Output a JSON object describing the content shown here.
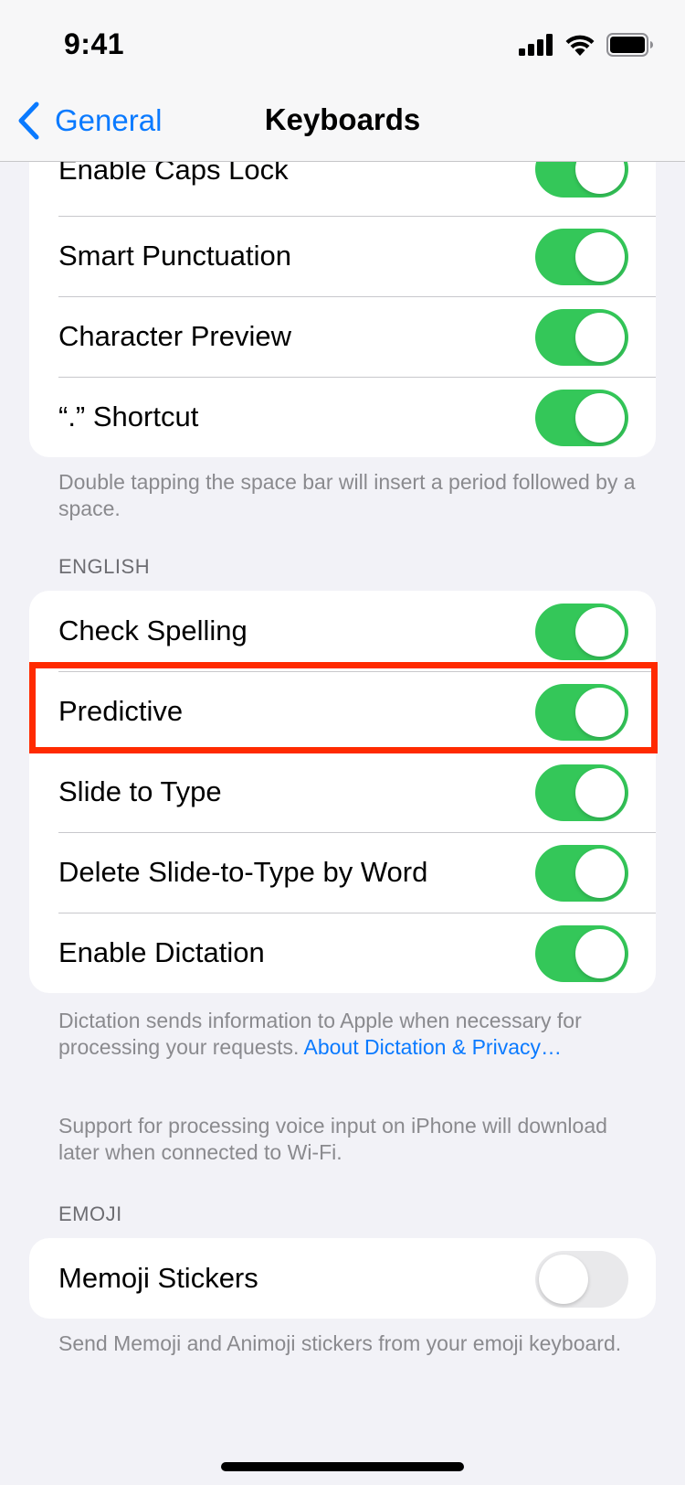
{
  "status_bar": {
    "time": "9:41",
    "icons": [
      "cellular-signal-icon",
      "wifi-icon",
      "battery-icon"
    ]
  },
  "nav": {
    "back_label": "General",
    "title": "Keyboards"
  },
  "group_top": {
    "rows": [
      {
        "label": "Enable Caps Lock",
        "on": true
      },
      {
        "label": "Smart Punctuation",
        "on": true
      },
      {
        "label": "Character Preview",
        "on": true
      },
      {
        "label": "“.” Shortcut",
        "on": true
      }
    ],
    "footer": "Double tapping the space bar will insert a period followed by a space."
  },
  "english": {
    "header": "ENGLISH",
    "rows": [
      {
        "label": "Check Spelling",
        "on": true
      },
      {
        "label": "Predictive",
        "on": true
      },
      {
        "label": "Slide to Type",
        "on": true
      },
      {
        "label": "Delete Slide-to-Type by Word",
        "on": true
      },
      {
        "label": "Enable Dictation",
        "on": true
      }
    ],
    "footer_text": "Dictation sends information to Apple when necessary for processing your requests.",
    "footer_link": "About Dictation & Privacy…",
    "footer_2": "Support for processing voice input on iPhone will download later when connected to Wi-Fi."
  },
  "emoji": {
    "header": "EMOJI",
    "rows": [
      {
        "label": "Memoji Stickers",
        "on": false
      }
    ],
    "footer": "Send Memoji and Animoji stickers from your emoji keyboard."
  },
  "colors": {
    "toggle_on": "#34c759",
    "toggle_off": "#e9e9eb",
    "link": "#0a7aff",
    "highlight": "#ff2a00"
  }
}
